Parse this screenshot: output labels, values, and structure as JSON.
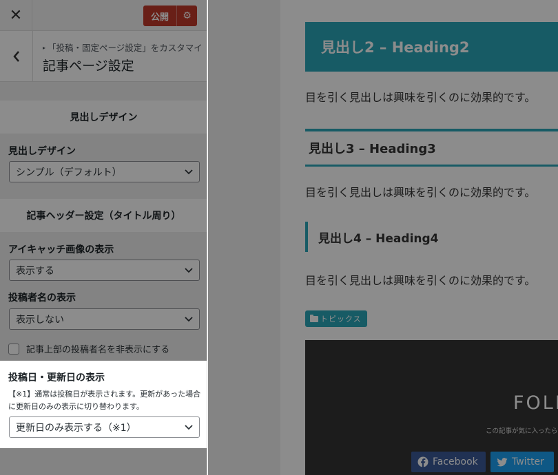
{
  "topbar": {
    "close_glyph": "✕",
    "publish_label": "公開",
    "gear_glyph": "⚙"
  },
  "section": {
    "back_glyph": "‹",
    "breadcrumb_marker": "▸",
    "breadcrumb": "「投稿・固定ページ設定」をカスタマイズ中",
    "title": "記事ページ設定"
  },
  "groups": {
    "heading_design": {
      "head": "見出しデザイン",
      "label": "見出しデザイン",
      "value": "シンプル（デフォルト）"
    },
    "article_header": {
      "head": "記事ヘッダー設定（タイトル周り）",
      "eyecatch_label": "アイキャッチ画像の表示",
      "eyecatch_value": "表示する",
      "author_label": "投稿者名の表示",
      "author_value": "表示しない",
      "hide_author_checkbox": "記事上部の投稿者名を非表示にする",
      "date_label": "投稿日・更新日の表示",
      "date_note": "【※1】通常は投稿日が表示されます。更新があった場合に更新日のみの表示に切り替わります。",
      "date_value": "更新日のみ表示する（※1）"
    }
  },
  "preview": {
    "h2": "見出し2 – Heading2",
    "paragraph": "目を引く見出しは興味を引くのに効果的です。",
    "h3": "見出し3 – Heading3",
    "h4": "見出し4 – Heading4",
    "category": "トピックス",
    "follow_title": "FOLLOW",
    "follow_sub": "この記事が気に入ったらフォローしよう",
    "facebook": "Facebook",
    "twitter": "Twitter"
  },
  "colors": {
    "accent": "#2aa6b8",
    "publish": "#c0392b",
    "facebook": "#3b5998",
    "twitter": "#1da1f2"
  }
}
